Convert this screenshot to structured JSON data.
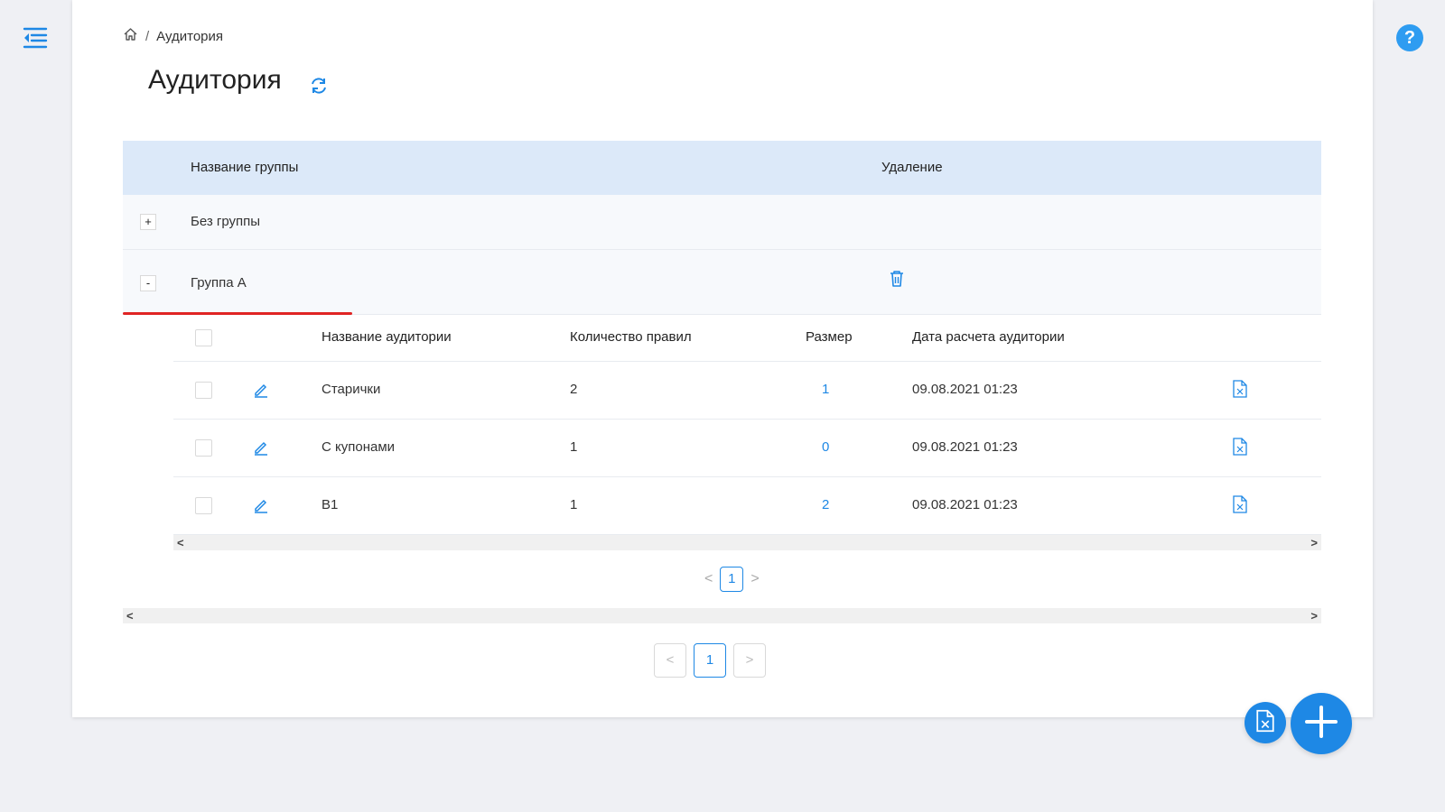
{
  "breadcrumb": {
    "current": "Аудитория",
    "separator": "/"
  },
  "page": {
    "title": "Аудитория"
  },
  "outer_table": {
    "headers": {
      "group_name": "Название группы",
      "delete": "Удаление"
    },
    "groups": [
      {
        "expander": "+",
        "name": "Без группы"
      },
      {
        "expander": "-",
        "name": "Группа А"
      }
    ]
  },
  "inner_table": {
    "headers": {
      "audience_name": "Название аудитории",
      "rules_count": "Количество правил",
      "size": "Размер",
      "calc_date": "Дата расчета аудитории"
    },
    "rows": [
      {
        "name": "Старички",
        "rules": "2",
        "size": "1",
        "date": "09.08.2021 01:23"
      },
      {
        "name": "С купонами",
        "rules": "1",
        "size": "0",
        "date": "09.08.2021 01:23"
      },
      {
        "name": "B1",
        "rules": "1",
        "size": "2",
        "date": "09.08.2021 01:23"
      }
    ]
  },
  "inner_pagination": {
    "prev": "<",
    "current": "1",
    "next": ">"
  },
  "outer_pagination": {
    "prev": "<",
    "current": "1",
    "next": ">"
  },
  "scrollbar": {
    "left": "<",
    "right": ">"
  },
  "help": {
    "label": "?"
  },
  "colors": {
    "accent": "#1e88e5",
    "header_bg": "#dce9f9",
    "highlight": "#e02424"
  },
  "icons": [
    "menu-collapse-icon",
    "help-icon",
    "home-icon",
    "refresh-icon",
    "trash-icon",
    "edit-icon",
    "excel-file-icon",
    "plus-icon"
  ]
}
